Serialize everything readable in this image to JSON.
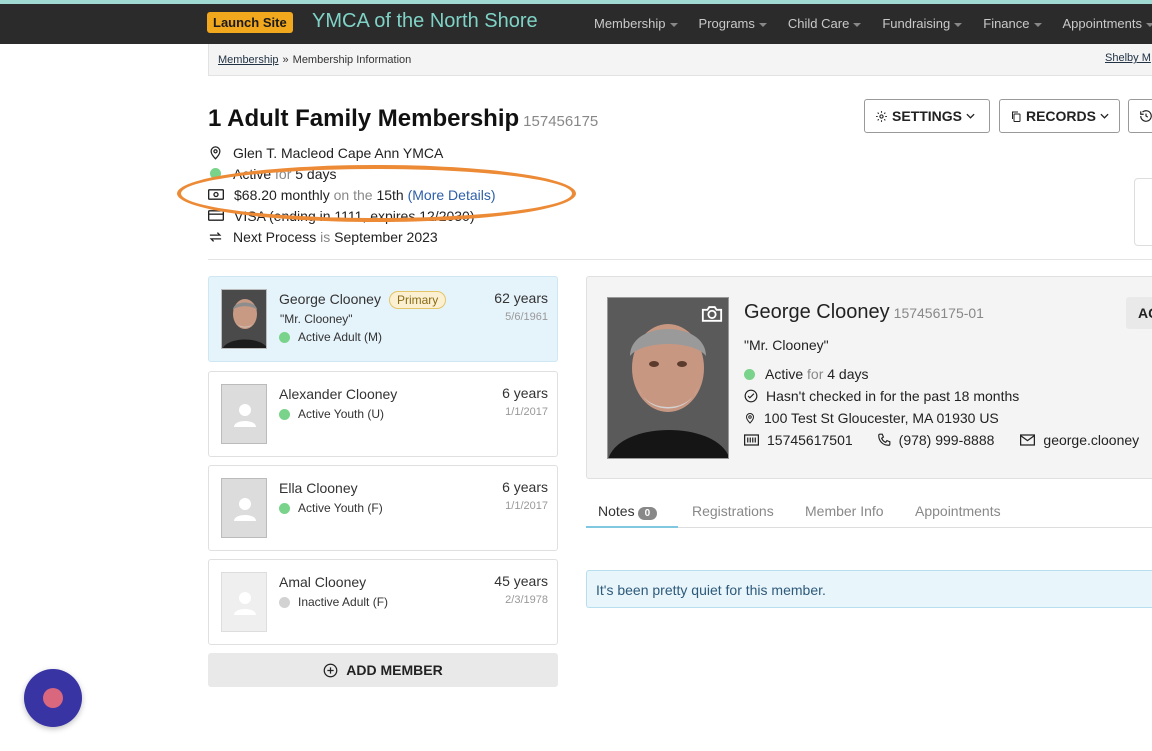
{
  "topbar": {
    "launch_label": "Launch Site",
    "org_name": "YMCA of the North Shore",
    "nav": [
      "Membership",
      "Programs",
      "Child Care",
      "Fundraising",
      "Finance",
      "Appointments"
    ]
  },
  "breadcrumb": {
    "parent": "Membership",
    "separator": "»",
    "current": "Membership Information",
    "user": "Shelby M"
  },
  "membership": {
    "title": "1 Adult Family Membership",
    "id": "157456175",
    "settings_label": "SETTINGS",
    "records_label": "RECORDS",
    "location": "Glen T. Macleod Cape Ann YMCA",
    "status_active": "Active",
    "status_for": "for",
    "status_duration": "5 days",
    "price": "$68.20 monthly",
    "price_on_the": "on the",
    "price_day": "15th",
    "more_details": "(More Details)",
    "card": "VISA (ending in 1111, expires 12/2030)",
    "next_label": "Next Process",
    "next_is": "is",
    "next_value": "September 2023"
  },
  "members": [
    {
      "name": "George Clooney",
      "badge": "Primary",
      "nickname": "\"Mr. Clooney\"",
      "status": "Active Adult (M)",
      "age": "62 years",
      "dob": "5/6/1961"
    },
    {
      "name": "Alexander Clooney",
      "status": "Active Youth (U)",
      "age": "6 years",
      "dob": "1/1/2017"
    },
    {
      "name": "Ella Clooney",
      "status": "Active Youth (F)",
      "age": "6 years",
      "dob": "1/1/2017"
    },
    {
      "name": "Amal Clooney",
      "status": "Inactive Adult (F)",
      "age": "45 years",
      "dob": "2/3/1978"
    }
  ],
  "add_member_label": "ADD MEMBER",
  "detail": {
    "name": "George Clooney",
    "id": "157456175-01",
    "nickname": "\"Mr. Clooney\"",
    "status_active": "Active",
    "status_for": "for",
    "status_duration": "4 days",
    "checkin": "Hasn't checked in for the past 18 months",
    "address": "100 Test St Gloucester, MA 01930 US",
    "barcode": "15745617501",
    "phone": "(978) 999-8888",
    "email": "george.clooney",
    "action_label": "AC"
  },
  "tabs": {
    "notes": "Notes",
    "notes_count": "0",
    "registrations": "Registrations",
    "member_info": "Member Info",
    "appointments": "Appointments"
  },
  "notice": "It's been pretty quiet for this member.",
  "colors": {
    "topbar_bg": "#2b2b2b",
    "org_text": "#7fd3c6",
    "launch_badge": "#f2a81d",
    "highlight_ellipse": "#ec8a36",
    "active_dot": "#79d38b",
    "selected_card": "#e5f3fb",
    "chat_button": "#3834a4"
  }
}
